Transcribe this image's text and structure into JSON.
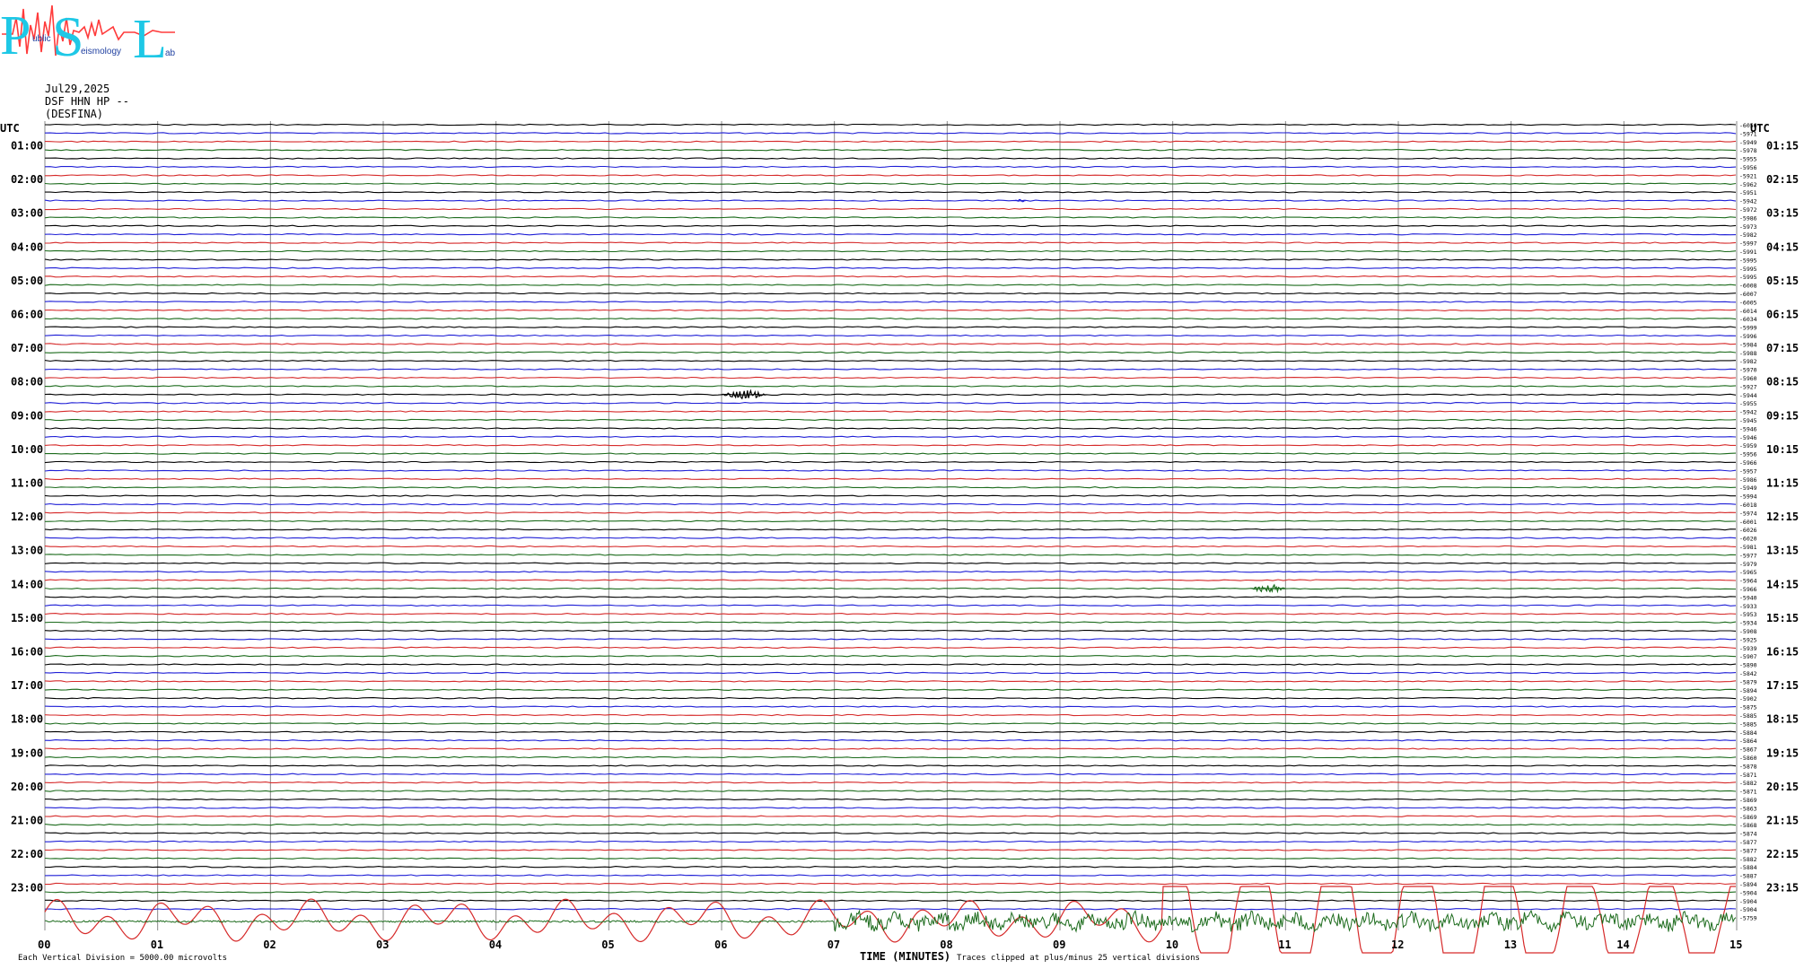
{
  "logo": {
    "letters": [
      "P",
      "S",
      "L"
    ],
    "text_a": "ublic",
    "text_b": "eismology",
    "text_c": "ab"
  },
  "header": {
    "date": "Jul29,2025",
    "station": "DSF HHN HP --",
    "site": "(DESFINA)"
  },
  "axes": {
    "left_title": "UTC",
    "right_title": "UTC",
    "left_hours": [
      "01:00",
      "02:00",
      "03:00",
      "04:00",
      "05:00",
      "06:00",
      "07:00",
      "08:00",
      "09:00",
      "10:00",
      "11:00",
      "12:00",
      "13:00",
      "14:00",
      "15:00",
      "16:00",
      "17:00",
      "18:00",
      "19:00",
      "20:00",
      "21:00",
      "22:00",
      "23:00"
    ],
    "right_hours": [
      "01:15",
      "02:15",
      "03:15",
      "04:15",
      "05:15",
      "06:15",
      "07:15",
      "08:15",
      "09:15",
      "10:15",
      "11:15",
      "12:15",
      "13:15",
      "14:15",
      "15:15",
      "16:15",
      "17:15",
      "18:15",
      "19:15",
      "20:15",
      "21:15",
      "22:15",
      "23:15"
    ],
    "x_ticks": [
      "00",
      "01",
      "02",
      "03",
      "04",
      "05",
      "06",
      "07",
      "08",
      "09",
      "10",
      "11",
      "12",
      "13",
      "14",
      "15"
    ],
    "x_title": "TIME (MINUTES)"
  },
  "offsets": [
    "-6056",
    "-5971",
    "-5949",
    "-5978",
    "-5955",
    "-5956",
    "-5921",
    "-5962",
    "-5951",
    "-5942",
    "-5972",
    "-5986",
    "-5973",
    "-5982",
    "-5997",
    "-5991",
    "-5995",
    "-5995",
    "-5995",
    "-6008",
    "-6007",
    "-6005",
    "-6014",
    "-6034",
    "-5999",
    "-5996",
    "-5984",
    "-5988",
    "-5982",
    "-5970",
    "-5960",
    "-5927",
    "-5944",
    "-5955",
    "-5942",
    "-5945",
    "-5946",
    "-5946",
    "-5959",
    "-5956",
    "-5966",
    "-5957",
    "-5986",
    "-5949",
    "-5994",
    "-6018",
    "-5974",
    "-6001",
    "-6026",
    "-6020",
    "-5981",
    "-5977",
    "-5979",
    "-5965",
    "-5964",
    "-5966",
    "-5940",
    "-5933",
    "-5953",
    "-5934",
    "-5908",
    "-5925",
    "-5939",
    "-5907",
    "-5890",
    "-5842",
    "-5879",
    "-5894",
    "-5902",
    "-5875",
    "-5885",
    "-5885",
    "-5884",
    "-5864",
    "-5867",
    "-5860",
    "-5878",
    "-5871",
    "-5882",
    "-5871",
    "-5869",
    "-5863",
    "-5869",
    "-5868",
    "-5874",
    "-5877",
    "-5877",
    "-5882",
    "-5884",
    "-5887",
    "-5894",
    "-5904",
    "-5904",
    "-5904",
    "-5759"
  ],
  "footer": {
    "left": "Each Vertical Division = 5000.00 microvolts",
    "right": "Traces clipped at plus/minus 25 vertical divisions"
  },
  "colors": {
    "trace_cycle": [
      "#000000",
      "#1f1fd6",
      "#d62a2a",
      "#1c6b1c"
    ],
    "grid": "#8a8a8a",
    "logo_blue": "#1ec8e6",
    "logo_red": "#ff3b3b"
  },
  "chart_data": {
    "type": "line",
    "title": "",
    "xlabel": "TIME (MINUTES)",
    "ylabel": "UTC",
    "xlim": [
      0,
      15
    ],
    "traces_per_hour": 4,
    "minutes_per_trace": 15,
    "trace_count": 96,
    "color_order": [
      "black",
      "blue",
      "red",
      "green"
    ],
    "events": [
      {
        "trace_label": "08:00",
        "minute": 6.0,
        "duration_min": 0.4,
        "peak_divisions": 3,
        "color": "black"
      },
      {
        "trace_label": "13:45",
        "minute": 10.7,
        "duration_min": 0.3,
        "peak_divisions": 3,
        "color": "green"
      },
      {
        "trace_label": "02:15",
        "minute": 8.6,
        "duration_min": 0.1,
        "peak_divisions": 1,
        "color": "blue"
      }
    ],
    "final_traces": [
      {
        "label": "23:30",
        "color": "green",
        "note": "Traces clipped at plus/minus 25 vertical divisions"
      },
      {
        "label": "23:45",
        "color": "blue",
        "start_minute": 7.0
      }
    ]
  }
}
